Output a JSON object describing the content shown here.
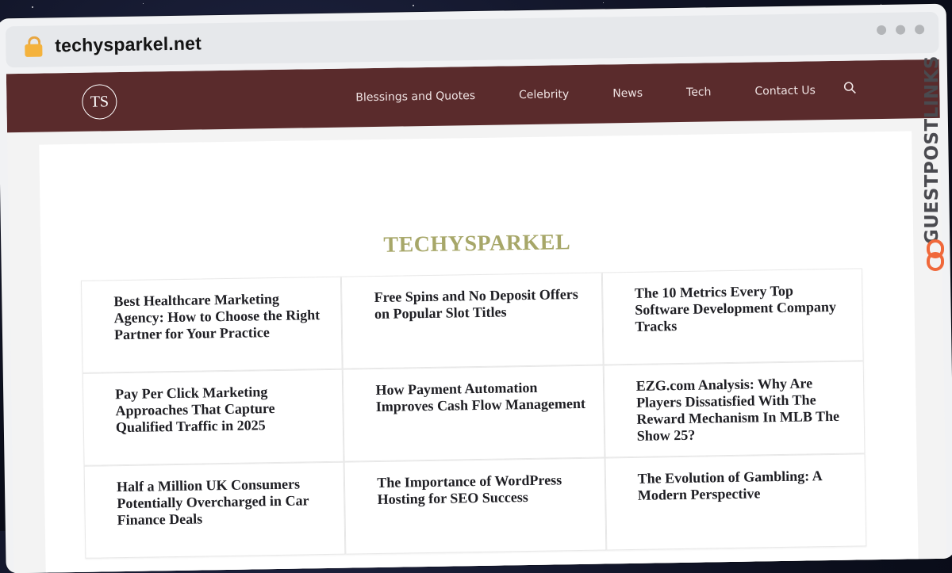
{
  "browser": {
    "url": "techysparkel.net"
  },
  "nav": {
    "logo_text": "TS",
    "items": [
      "Blessings and Quotes",
      "Celebrity",
      "News",
      "Tech",
      "Contact Us"
    ]
  },
  "watermark": {
    "text": "GUESTPOSTLINKS"
  },
  "site": {
    "title": "TECHYSPARKEL"
  },
  "articles": [
    "Best Healthcare Marketing Agency: How to Choose the Right Partner for Your Practice",
    "Free Spins and No Deposit Offers on Popular Slot Titles",
    "The 10 Metrics Every Top Software Development Company Tracks",
    "Pay Per Click Marketing Approaches That Capture Qualified Traffic in 2025",
    "How Payment Automation Improves Cash Flow Management",
    "EZG.com Analysis: Why Are Players Dissatisfied With The Reward Mechanism In MLB The Show 25?",
    "Half a Million UK Consumers Potentially Overcharged in Car Finance Deals",
    "The Importance of WordPress Hosting for SEO Success",
    "The Evolution of Gambling: A Modern Perspective"
  ],
  "colors": {
    "nav_bg": "#5a2b2c",
    "title": "#a7a769",
    "brand_accent": "#f0683a"
  }
}
